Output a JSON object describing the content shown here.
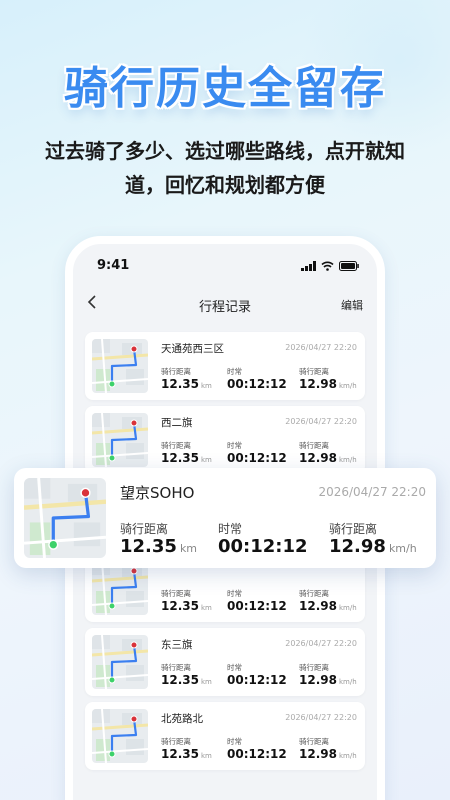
{
  "hero": {
    "title": "骑行历史全留存",
    "subtitle_line1": "过去骑了多少、选过哪些路线，点开就知",
    "subtitle_line2": "道，回忆和规划都方便"
  },
  "status_bar": {
    "time": "9:41"
  },
  "nav": {
    "back_icon": "chevron-left-icon",
    "title": "行程记录",
    "edit": "编辑"
  },
  "labels": {
    "distance": "骑行距离",
    "duration": "时常",
    "speed": "骑行距离",
    "unit_km": "km",
    "unit_kmh": "km/h"
  },
  "records": [
    {
      "place": "天通苑西三区",
      "date": "2026/04/27 22:20",
      "distance": "12.35",
      "duration": "00:12:12",
      "speed": "12.98"
    },
    {
      "place": "西二旗",
      "date": "2026/04/27 22:20",
      "distance": "12.35",
      "duration": "00:12:12",
      "speed": "12.98"
    },
    {
      "place": "",
      "date": "",
      "distance": "12.35",
      "duration": "00:12:12",
      "speed": "12.98"
    },
    {
      "place": "东三旗",
      "date": "2026/04/27 22:20",
      "distance": "12.35",
      "duration": "00:12:12",
      "speed": "12.98"
    },
    {
      "place": "北苑路北",
      "date": "2026/04/27 22:20",
      "distance": "12.35",
      "duration": "00:12:12",
      "speed": "12.98"
    }
  ],
  "featured": {
    "place": "望京SOHO",
    "date": "2026/04/27 22:20",
    "distance": "12.35",
    "duration": "00:12:12",
    "speed": "12.98"
  },
  "colors": {
    "accent": "#3a8bf0",
    "route": "#3b7ff0",
    "start": "#3ed16a",
    "end": "#d9323a"
  }
}
